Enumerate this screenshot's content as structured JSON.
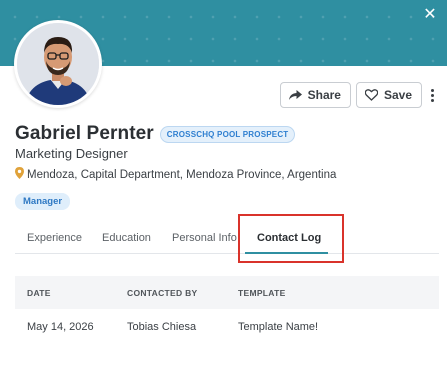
{
  "profile": {
    "name": "Gabriel Pernter",
    "badge": "CROSSCHQ POOL PROSPECT",
    "job_title": "Marketing Designer",
    "location": "Mendoza, Capital Department, Mendoza Province, Argentina",
    "tag": "Manager"
  },
  "actions": {
    "share_label": "Share",
    "save_label": "Save"
  },
  "tabs": [
    {
      "label": "Experience"
    },
    {
      "label": "Education"
    },
    {
      "label": "Personal Info"
    },
    {
      "label": "Contact Log",
      "active": true
    }
  ],
  "contact_log": {
    "columns": [
      "DATE",
      "CONTACTED BY",
      "TEMPLATE"
    ],
    "rows": [
      {
        "date": "May 14, 2026",
        "contacted_by": "Tobias Chiesa",
        "template": "Template Name!"
      }
    ]
  },
  "colors": {
    "banner": "#2f8fa1",
    "highlight": "#d9332b",
    "badge_text": "#2f7fd0"
  },
  "icons": [
    "close-icon",
    "share-icon",
    "heart-icon",
    "more-vertical-icon",
    "location-pin-icon"
  ]
}
